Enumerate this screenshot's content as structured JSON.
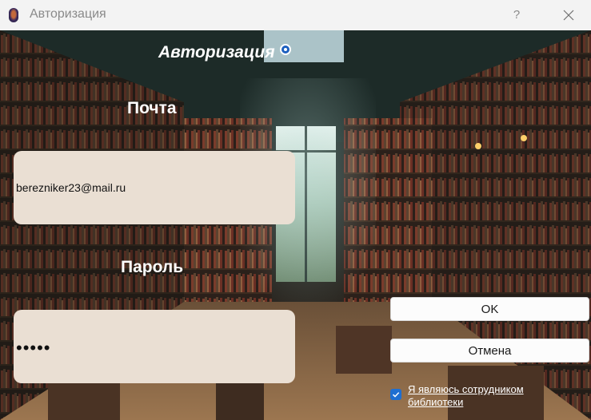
{
  "window": {
    "title": "Авторизация",
    "help_label": "?"
  },
  "form": {
    "heading": "Авторизация",
    "email_label": "Почта",
    "email_value": "berezniker23@mail.ru",
    "password_label": "Пароль",
    "password_masked": "•••••",
    "ok_label": "OK",
    "cancel_label": "Отмена",
    "employee_checkbox_label": "Я являюсь сотрудником библиотеки",
    "employee_checkbox_checked": true
  },
  "colors": {
    "field_bg": "#eadfd3",
    "checkbox_accent": "#1f6fd1",
    "radio_accent": "#1c5fbf"
  }
}
